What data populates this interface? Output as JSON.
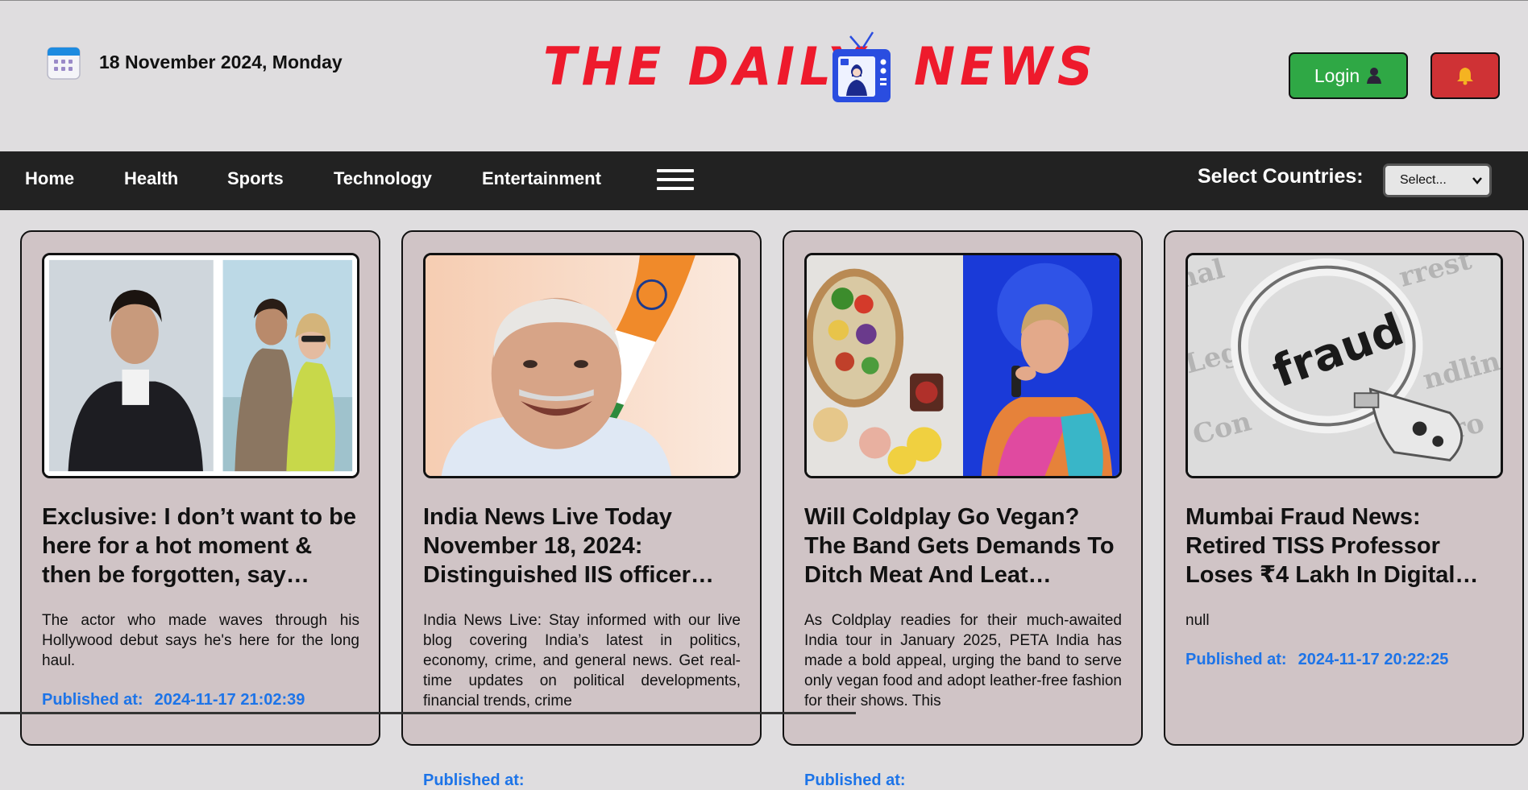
{
  "header": {
    "date": "18 November 2024, Monday",
    "logo_left": "THE DAILY",
    "logo_right": "NEWS",
    "login_label": "Login"
  },
  "nav": {
    "items": [
      "Home",
      "Health",
      "Sports",
      "Technology",
      "Entertainment"
    ],
    "countries_label": "Select Countries:",
    "select_value": "Select..."
  },
  "cards": [
    {
      "title": "Exclusive: I don’t want to be here for a hot moment & then be forgotten, say…",
      "description": "The actor who made waves through his Hollywood debut says he's here for the long haul.",
      "published_label": "Published at:",
      "published_at": "2024-11-17 21:02:39"
    },
    {
      "title": "India News Live Today November 18, 2024: Distinguished IIS officer…",
      "description": "India News Live: Stay informed with our live blog covering India’s latest in politics, economy, crime, and general news. Get real-time updates on political developments, financial trends, crime",
      "published_label": "Published at:",
      "published_at": ""
    },
    {
      "title": "Will Coldplay Go Vegan? The Band Gets Demands To Ditch Meat And Leat…",
      "description": "As Coldplay readies for their much-awaited India tour in January 2025, PETA India has made a bold appeal, urging the band to serve only vegan food and adopt leather-free fashion for their shows. This",
      "published_label": "Published at:",
      "published_at": ""
    },
    {
      "title": "Mumbai Fraud News: Retired TISS Professor Loses ₹4 Lakh In Digital…",
      "description": "null",
      "published_label": "Published at:",
      "published_at": "2024-11-17 20:22:25"
    }
  ],
  "images": {
    "fraud_word": "fraud"
  },
  "colors": {
    "logo_red": "#ee1a2c",
    "login_green": "#2fa845",
    "bell_red": "#cf3235",
    "nav_bg": "#222222",
    "link_blue": "#1d74e8",
    "card_bg": "#d0c4c6"
  },
  "icons": {
    "date": "calendar-icon",
    "logo": "tv-news-icon",
    "login": "user-icon",
    "bell": "bell-icon",
    "menu": "hamburger-menu-icon",
    "select": "chevron-down-icon"
  }
}
